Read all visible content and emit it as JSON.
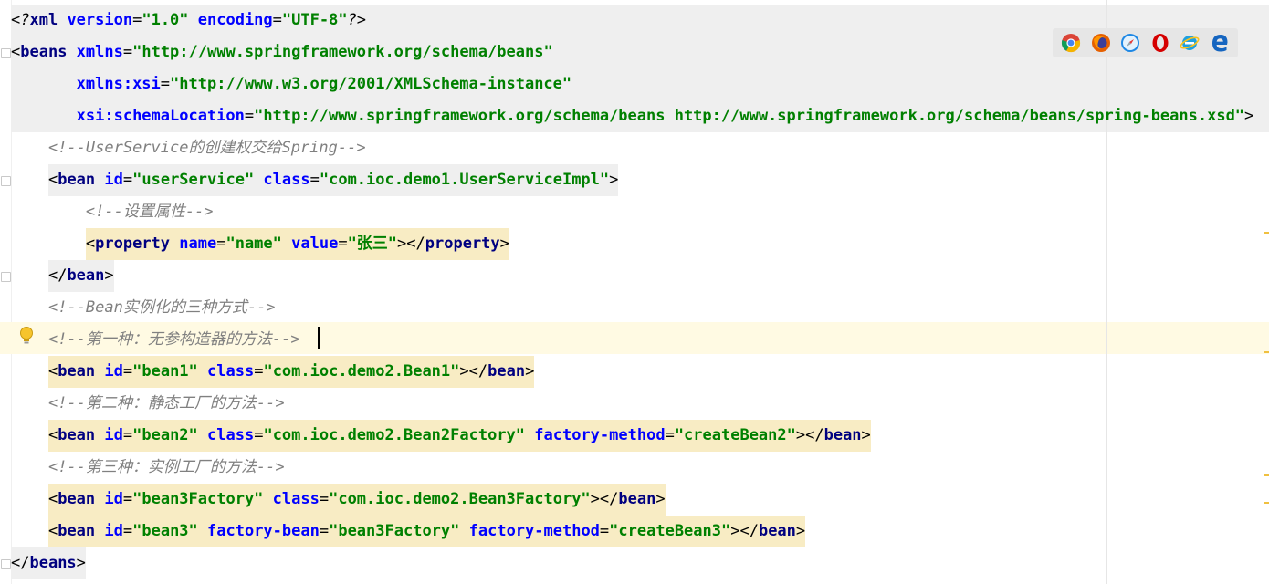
{
  "editor": {
    "language": "XML",
    "lines": [
      [
        [
          "pi",
          "<?"
        ],
        [
          "t",
          "xml "
        ],
        [
          "a",
          "version"
        ],
        [
          "p",
          "="
        ],
        [
          "v",
          "\"1.0\" "
        ],
        [
          "a",
          "encoding"
        ],
        [
          "p",
          "="
        ],
        [
          "v",
          "\"UTF-8\""
        ],
        [
          "pi",
          "?>"
        ]
      ],
      [
        [
          "p",
          "<"
        ],
        [
          "t",
          "beans "
        ],
        [
          "a",
          "xmlns"
        ],
        [
          "p",
          "="
        ],
        [
          "v",
          "\"http://www.springframework.org/schema/beans\""
        ]
      ],
      [
        [
          "p",
          "       "
        ],
        [
          "a",
          "xmlns:xsi"
        ],
        [
          "p",
          "="
        ],
        [
          "v",
          "\"http://www.w3.org/2001/XMLSchema-instance\""
        ]
      ],
      [
        [
          "p",
          "       "
        ],
        [
          "a",
          "xsi:schemaLocation"
        ],
        [
          "p",
          "="
        ],
        [
          "v",
          "\"http://www.springframework.org/schema/beans http://www.springframework.org/schema/beans/spring-beans.xsd\""
        ],
        [
          "p",
          ">"
        ]
      ],
      [
        [
          "p",
          "    "
        ],
        [
          "c",
          "<!--UserService的创建权交给Spring-->"
        ]
      ],
      [
        [
          "p",
          "    <"
        ],
        [
          "t",
          "bean "
        ],
        [
          "a",
          "id"
        ],
        [
          "p",
          "="
        ],
        [
          "v",
          "\"userService\" "
        ],
        [
          "a",
          "class"
        ],
        [
          "p",
          "="
        ],
        [
          "v",
          "\"com.ioc.demo1.UserServiceImpl\""
        ],
        [
          "p",
          ">"
        ]
      ],
      [
        [
          "p",
          "        "
        ],
        [
          "c",
          "<!--设置属性-->"
        ]
      ],
      [
        [
          "p",
          "        <"
        ],
        [
          "t",
          "property "
        ],
        [
          "a",
          "name"
        ],
        [
          "p",
          "="
        ],
        [
          "v",
          "\"name\" "
        ],
        [
          "a",
          "value"
        ],
        [
          "p",
          "="
        ],
        [
          "v",
          "\"张三\""
        ],
        [
          "p",
          "></"
        ],
        [
          "t",
          "property"
        ],
        [
          "p",
          ">"
        ]
      ],
      [
        [
          "p",
          "    </"
        ],
        [
          "t",
          "bean"
        ],
        [
          "p",
          ">"
        ]
      ],
      [
        [
          "p",
          "    "
        ],
        [
          "c",
          "<!--Bean实例化的三种方式-->"
        ]
      ],
      [
        [
          "p",
          "    "
        ],
        [
          "c",
          "<!--第一种：无参构造器的方法-->"
        ]
      ],
      [
        [
          "p",
          "    <"
        ],
        [
          "t",
          "bean "
        ],
        [
          "a",
          "id"
        ],
        [
          "p",
          "="
        ],
        [
          "v",
          "\"bean1\" "
        ],
        [
          "a",
          "class"
        ],
        [
          "p",
          "="
        ],
        [
          "v",
          "\"com.ioc.demo2.Bean1\""
        ],
        [
          "p",
          "></"
        ],
        [
          "t",
          "bean"
        ],
        [
          "p",
          ">"
        ]
      ],
      [
        [
          "p",
          "    "
        ],
        [
          "c",
          "<!--第二种：静态工厂的方法-->"
        ]
      ],
      [
        [
          "p",
          "    <"
        ],
        [
          "t",
          "bean "
        ],
        [
          "a",
          "id"
        ],
        [
          "p",
          "="
        ],
        [
          "v",
          "\"bean2\" "
        ],
        [
          "a",
          "class"
        ],
        [
          "p",
          "="
        ],
        [
          "v",
          "\"com.ioc.demo2.Bean2Factory\" "
        ],
        [
          "a",
          "factory-method"
        ],
        [
          "p",
          "="
        ],
        [
          "v",
          "\"createBean2\""
        ],
        [
          "p",
          "></"
        ],
        [
          "t",
          "bean"
        ],
        [
          "p",
          ">"
        ]
      ],
      [
        [
          "p",
          "    "
        ],
        [
          "c",
          "<!--第三种：实例工厂的方法-->"
        ]
      ],
      [
        [
          "p",
          "    <"
        ],
        [
          "t",
          "bean "
        ],
        [
          "a",
          "id"
        ],
        [
          "p",
          "="
        ],
        [
          "v",
          "\"bean3Factory\" "
        ],
        [
          "a",
          "class"
        ],
        [
          "p",
          "="
        ],
        [
          "v",
          "\"com.ioc.demo2.Bean3Factory\""
        ],
        [
          "p",
          "></"
        ],
        [
          "t",
          "bean"
        ],
        [
          "p",
          ">"
        ]
      ],
      [
        [
          "p",
          "    <"
        ],
        [
          "t",
          "bean "
        ],
        [
          "a",
          "id"
        ],
        [
          "p",
          "="
        ],
        [
          "v",
          "\"bean3\" "
        ],
        [
          "a",
          "factory-bean"
        ],
        [
          "p",
          "="
        ],
        [
          "v",
          "\"bean3Factory\" "
        ],
        [
          "a",
          "factory-method"
        ],
        [
          "p",
          "="
        ],
        [
          "v",
          "\"createBean3\""
        ],
        [
          "p",
          "></"
        ],
        [
          "t",
          "bean"
        ],
        [
          "p",
          ">"
        ]
      ],
      [
        [
          "p",
          "</"
        ],
        [
          "t",
          "beans"
        ],
        [
          "p",
          ">"
        ]
      ]
    ],
    "line_highlight": [
      "grey",
      "grey",
      "grey",
      "grey",
      "none",
      "grey",
      "none",
      "yellow",
      "grey",
      "none",
      "none",
      "yellow",
      "none",
      "yellow",
      "none",
      "yellow",
      "yellow",
      "grey"
    ],
    "caret_line_index": 10,
    "fold_marker_lines": [
      1,
      5,
      8,
      17
    ]
  },
  "browser_bar": {
    "icons": [
      "chrome-icon",
      "firefox-icon",
      "safari-icon",
      "opera-icon",
      "internet-explorer-icon",
      "edge-icon"
    ],
    "colors": {
      "chrome": [
        "#db4437",
        "#f4b400",
        "#0f9d58",
        "#4285f4"
      ],
      "firefox": "#e66000",
      "safari": "#1e88e5",
      "opera": "#d50000",
      "ie": "#1ea0e0",
      "edge": "#1565c0"
    }
  },
  "intention_icon": "lightbulb-icon",
  "colors": {
    "tag": "#000080",
    "attribute": "#0000ff",
    "value": "#008000",
    "comment": "#808080",
    "caret_line": "#fffae3",
    "block_highlight": "#efefef",
    "tag_highlight": "#f8ecc4"
  }
}
